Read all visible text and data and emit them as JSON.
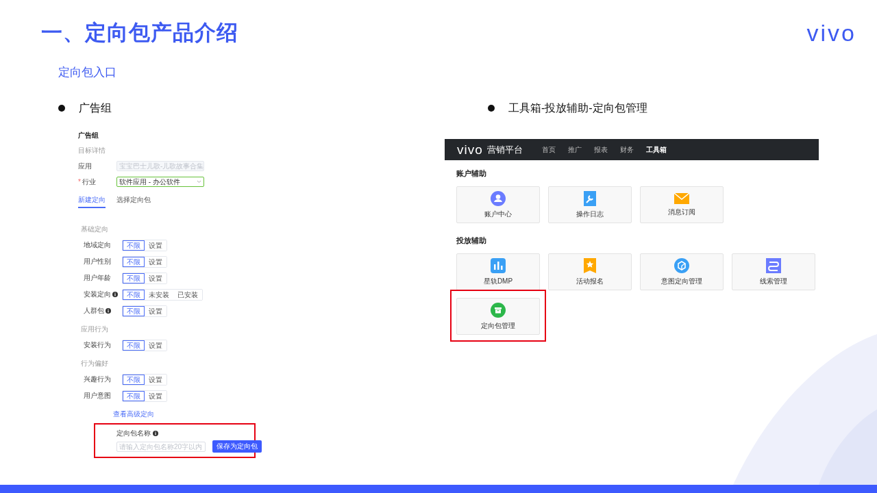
{
  "title": "一、定向包产品介绍",
  "logo": "vivo",
  "subtitle": "定向包入口",
  "left": {
    "bullet": "广告组",
    "form": {
      "title": "广告组",
      "section_label": "目标详情",
      "fields": [
        {
          "kind": "text",
          "label": "应用",
          "value": "宝宝巴士儿歌-儿歌故事合集",
          "disabled": true
        },
        {
          "kind": "select",
          "required_mark": "*",
          "label": "行业",
          "value": "软件应用 - 办公软件",
          "disabled": false
        }
      ],
      "tabs": [
        {
          "label": "新建定向",
          "selected": true
        },
        {
          "label": "选择定向包",
          "selected": false
        }
      ],
      "groups": [
        {
          "heading": "基础定向",
          "rows": [
            {
              "label": "地域定向",
              "info": false,
              "options": [
                {
                  "label": "不限",
                  "selected": true
                },
                {
                  "label": "设置",
                  "selected": false
                }
              ]
            },
            {
              "label": "用户性别",
              "info": false,
              "options": [
                {
                  "label": "不限",
                  "selected": true
                },
                {
                  "label": "设置",
                  "selected": false
                }
              ]
            },
            {
              "label": "用户年龄",
              "info": false,
              "options": [
                {
                  "label": "不限",
                  "selected": true
                },
                {
                  "label": "设置",
                  "selected": false
                }
              ]
            },
            {
              "label": "安装定向",
              "info": true,
              "options": [
                {
                  "label": "不限",
                  "selected": true
                },
                {
                  "label": "未安装",
                  "selected": false
                },
                {
                  "label": "已安装",
                  "selected": false
                }
              ]
            },
            {
              "label": "人群包",
              "info": true,
              "options": [
                {
                  "label": "不限",
                  "selected": true
                },
                {
                  "label": "设置",
                  "selected": false
                }
              ]
            }
          ]
        },
        {
          "heading": "应用行为",
          "rows": [
            {
              "label": "安装行为",
              "info": false,
              "options": [
                {
                  "label": "不限",
                  "selected": true
                },
                {
                  "label": "设置",
                  "selected": false
                }
              ]
            }
          ]
        },
        {
          "heading": "行为偏好",
          "rows": [
            {
              "label": "兴趣行为",
              "info": false,
              "options": [
                {
                  "label": "不限",
                  "selected": true
                },
                {
                  "label": "设置",
                  "selected": false
                }
              ]
            },
            {
              "label": "用户意图",
              "info": false,
              "options": [
                {
                  "label": "不限",
                  "selected": true
                },
                {
                  "label": "设置",
                  "selected": false
                }
              ]
            }
          ]
        }
      ],
      "advanced_link": "查看高级定向",
      "save": {
        "highlighted": true,
        "label": "定向包名称",
        "info": true,
        "placeholder": "请输入定向包名称20字以内",
        "button": "保存为定向包"
      }
    }
  },
  "right": {
    "bullet": "工具箱-投放辅助-定向包管理",
    "platform": {
      "logo": "vivo",
      "name": "营销平台",
      "nav": [
        {
          "label": "首页",
          "selected": false
        },
        {
          "label": "推广",
          "selected": false
        },
        {
          "label": "报表",
          "selected": false
        },
        {
          "label": "财务",
          "selected": false
        },
        {
          "label": "工具箱",
          "selected": true
        }
      ],
      "sections": [
        {
          "heading": "账户辅助",
          "tools": [
            {
              "label": "账户中心",
              "kind": "person",
              "highlighted": false
            },
            {
              "label": "操作日志",
              "kind": "wrench",
              "highlighted": false
            },
            {
              "label": "消息订阅",
              "kind": "mail",
              "highlighted": false
            }
          ]
        },
        {
          "heading": "投放辅助",
          "tools": [
            {
              "label": "星轨DMP",
              "kind": "chart",
              "highlighted": false
            },
            {
              "label": "活动报名",
              "kind": "star",
              "highlighted": false
            },
            {
              "label": "意图定向管理",
              "kind": "cube",
              "highlighted": false
            },
            {
              "label": "线索管理",
              "kind": "flow",
              "highlighted": false
            },
            {
              "label": "定向包管理",
              "kind": "box",
              "highlighted": true
            }
          ]
        }
      ]
    }
  }
}
